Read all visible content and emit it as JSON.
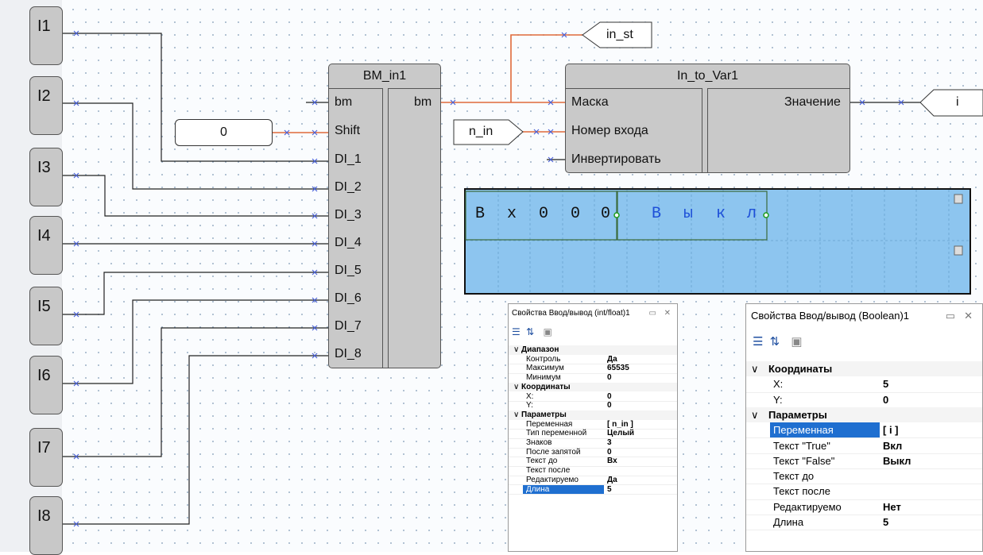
{
  "inputs": [
    "I1",
    "I2",
    "I3",
    "I4",
    "I5",
    "I6",
    "I7",
    "I8"
  ],
  "bm_block": {
    "title": "BM_in1",
    "inputs": [
      "bm",
      "Shift",
      "DI_1",
      "DI_2",
      "DI_3",
      "DI_4",
      "DI_5",
      "DI_6",
      "DI_7",
      "DI_8"
    ],
    "output": "bm"
  },
  "const_value": "0",
  "var_block": {
    "title": "In_to_Var1",
    "inputs": [
      "Маска",
      "Номер входа",
      "Инвертировать"
    ],
    "output": "Значение"
  },
  "tags": {
    "in_st": "in_st",
    "n_in": "n_in",
    "i": "i"
  },
  "lcd": {
    "line1_left": [
      "В",
      "х",
      "0",
      "0",
      "0"
    ],
    "line1_right": [
      "В",
      "ы",
      "к",
      "л"
    ]
  },
  "panel_int": {
    "title": "Свойства Ввод/вывод (int/float)1",
    "sections": [
      {
        "name": "Диапазон",
        "rows": [
          [
            "Контроль",
            "Да"
          ],
          [
            "Максимум",
            "65535"
          ],
          [
            "Минимум",
            "0"
          ]
        ]
      },
      {
        "name": "Координаты",
        "rows": [
          [
            "X:",
            "0"
          ],
          [
            "Y:",
            "0"
          ]
        ]
      },
      {
        "name": "Параметры",
        "rows": [
          [
            "Переменная",
            "[ n_in ]"
          ],
          [
            "Тип переменной",
            "Целый"
          ],
          [
            "Знаков",
            "3"
          ],
          [
            "После запятой",
            "0"
          ],
          [
            "Текст до",
            "Вх"
          ],
          [
            "Текст после",
            ""
          ],
          [
            "Редактируемо",
            "Да"
          ],
          [
            "Длина",
            "5"
          ]
        ]
      }
    ]
  },
  "panel_bool": {
    "title": "Свойства Ввод/вывод (Boolean)1",
    "sections": [
      {
        "name": "Координаты",
        "rows": [
          [
            "X:",
            "5"
          ],
          [
            "Y:",
            "0"
          ]
        ]
      },
      {
        "name": "Параметры",
        "rows": [
          [
            "Переменная",
            "[ i ]"
          ],
          [
            "Текст \"True\"",
            "Вкл"
          ],
          [
            "Текст \"False\"",
            "Выкл"
          ],
          [
            "Текст до",
            ""
          ],
          [
            "Текст после",
            ""
          ],
          [
            "Редактируемо",
            "Нет"
          ],
          [
            "Длина",
            "5"
          ]
        ]
      }
    ]
  },
  "colors": {
    "wire": "#222222",
    "active_wire": "#e06a3a",
    "lcd_bg": "#8dc5ef",
    "lcd_text": "#1e50d8",
    "selection": "#1f6fd0"
  }
}
